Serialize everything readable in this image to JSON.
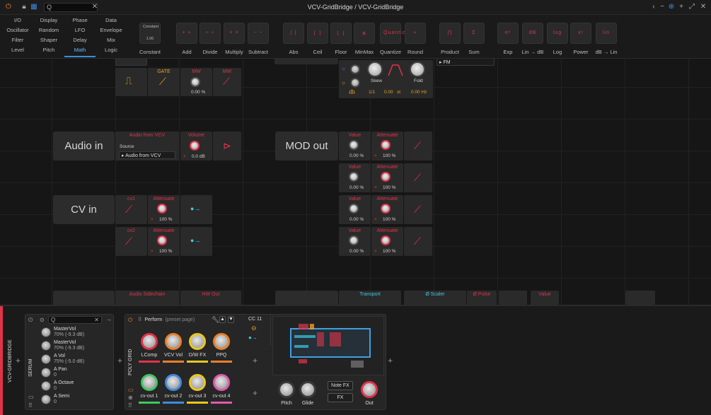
{
  "window": {
    "title": "VCV-GridBridge / VCV-GridBridge",
    "search_prompt": "Q"
  },
  "browser": {
    "categories": [
      [
        "I/O",
        "Display",
        "Phase",
        "Data"
      ],
      [
        "Oscillator",
        "Random",
        "LFO",
        "Envelope"
      ],
      [
        "Filter",
        "Shaper",
        "Delay",
        "Mix"
      ],
      [
        "Level",
        "Pitch",
        "Math",
        "Logic"
      ]
    ],
    "active_category": "Math",
    "devices": [
      {
        "label": "Constant",
        "glyph": "Constant"
      },
      {
        "label": "Add",
        "glyph": "+ +"
      },
      {
        "label": "Divide",
        "glyph": "÷ ÷"
      },
      {
        "label": "Multiply",
        "glyph": "× ×"
      },
      {
        "label": "Subtract",
        "glyph": "− −"
      },
      {
        "label": "Abs",
        "glyph": "| |"
      },
      {
        "label": "Ceil",
        "glyph": "⌈ ⌉"
      },
      {
        "label": "Floor",
        "glyph": "⌊ ⌋"
      },
      {
        "label": "MinMax",
        "glyph": "≶"
      },
      {
        "label": "Quantize",
        "glyph": "Quantize"
      },
      {
        "label": "Round",
        "glyph": "≈"
      },
      {
        "label": "Product",
        "glyph": "∏"
      },
      {
        "label": "Sum",
        "glyph": "Σ"
      },
      {
        "label": "Exp",
        "glyph": "eˣ"
      },
      {
        "label": "Lin → dB",
        "glyph": "dB"
      },
      {
        "label": "Log",
        "glyph": "log"
      },
      {
        "label": "Power",
        "glyph": "xʸ"
      },
      {
        "label": "dB → Lin",
        "glyph": "lin"
      }
    ],
    "constant_value": "1.00"
  },
  "grid": {
    "gate": {
      "title": "GATE"
    },
    "mw1": {
      "title": "MW",
      "value": "0.00 %"
    },
    "mw2": {
      "title": "MW"
    },
    "skew": {
      "label": "Skew"
    },
    "fold": {
      "label": "Fold"
    },
    "ratio": "1/1",
    "phase": "0.00",
    "unit": "st",
    "freq": "0.00 Hz",
    "fm_dropdown": "FM",
    "audio_in": {
      "label": "Audio in",
      "module_title": "Audio from VCV",
      "source_label": "Source",
      "source_value": "Audio from VCV",
      "volume_title": "Volume",
      "volume_value": "0.0 dB"
    },
    "mod_out": {
      "label": "MOD out",
      "rows": [
        {
          "value_title": "Value",
          "value": "0.00 %",
          "att_title": "Attenuate",
          "att": "100 %"
        },
        {
          "value_title": "Value",
          "value": "0.00 %",
          "att_title": "Attenuate",
          "att": "100 %"
        },
        {
          "value_title": "Value",
          "value": "0.00 %",
          "att_title": "Attenuate",
          "att": "100 %"
        },
        {
          "value_title": "Value",
          "value": "0.00 %",
          "att_title": "Attenuate",
          "att": "100 %"
        }
      ]
    },
    "cv_in": {
      "label": "CV in",
      "rows": [
        {
          "name": "cv1",
          "att_title": "Attenuate",
          "att": "100 %"
        },
        {
          "name": "cv2",
          "att_title": "Attenuate",
          "att": "100 %"
        }
      ]
    },
    "bottom_row": [
      {
        "title": "Audio Sidechain",
        "class": ""
      },
      {
        "title": "HW Out",
        "class": ""
      },
      {
        "title": "Transport",
        "class": "cyan"
      },
      {
        "title": "Ø Scaler",
        "class": "cyan"
      },
      {
        "title": "Ø Pulse",
        "class": ""
      },
      {
        "title": "Value",
        "class": ""
      }
    ]
  },
  "device_panel": {
    "track_name": "VCV-GRIDBRIDGE",
    "serum_label": "SERUM",
    "search_prompt": "Q",
    "params": [
      {
        "name": "MasterVol",
        "value": "70% (-9.3 dB)"
      },
      {
        "name": "MasterVol",
        "value": "70% (-9.3 dB)"
      },
      {
        "name": "A Vol",
        "value": "75% (-5.0 dB)"
      },
      {
        "name": "A Pan",
        "value": "0"
      },
      {
        "name": "A Octave",
        "value": "0"
      },
      {
        "name": "A Semi",
        "value": "0"
      }
    ],
    "poly_grid_label": "POLY GRID",
    "preset_page": "Perform",
    "preset_page_suffix": "(preset page)",
    "knobs": [
      {
        "label": "LComp",
        "color": "#e0334a"
      },
      {
        "label": "VCV Vol",
        "color": "#e8802a"
      },
      {
        "label": "D/W FX",
        "color": "#e8c820"
      },
      {
        "label": "PPQ",
        "color": "#e8802a"
      },
      {
        "label": "cv-out 1",
        "color": "#3fc860"
      },
      {
        "label": "cv-out 2",
        "color": "#3f8ce0"
      },
      {
        "label": "cv-out 3",
        "color": "#e8c820"
      },
      {
        "label": "cv-out 4",
        "color": "#e05ab0"
      }
    ],
    "cc_label": "CC 11",
    "pitch_label": "Pitch",
    "glide_label": "Glide",
    "out_label": "Out",
    "note_fx": "Note FX",
    "fx": "FX"
  }
}
